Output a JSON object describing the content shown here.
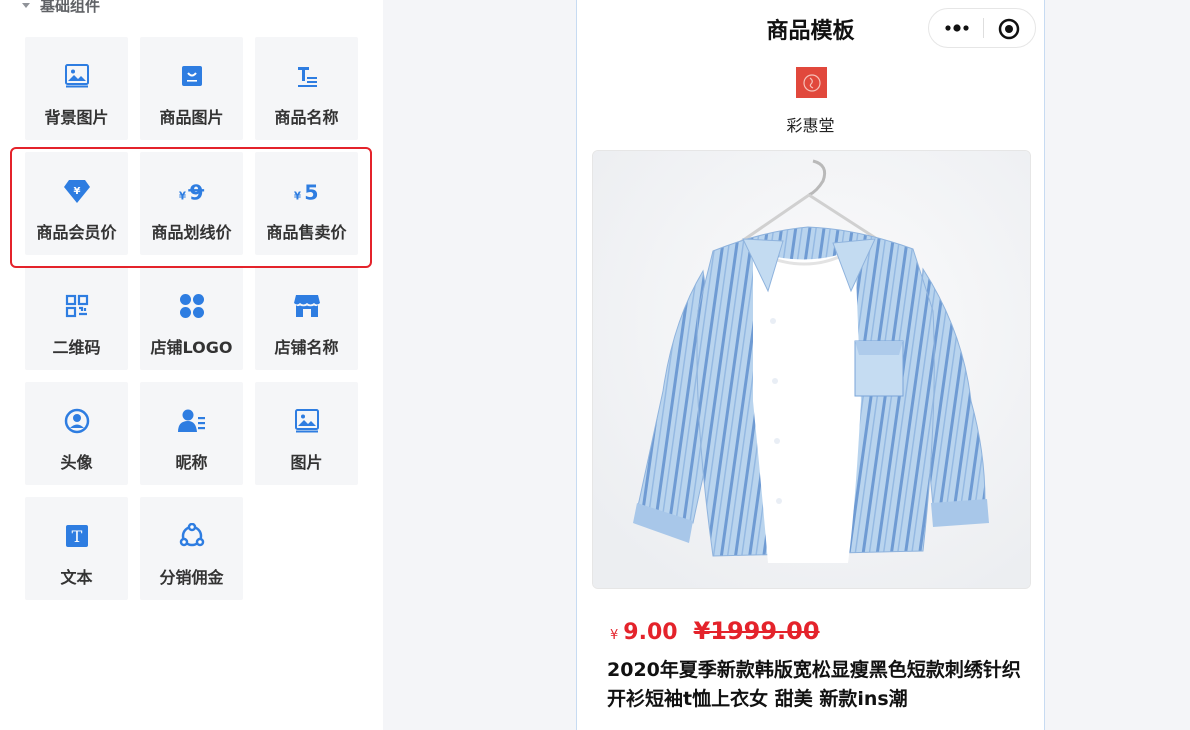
{
  "panel": {
    "section_title": "基础组件",
    "components": [
      {
        "label": "背景图片",
        "icon": "background-image-icon"
      },
      {
        "label": "商品图片",
        "icon": "product-image-icon"
      },
      {
        "label": "商品名称",
        "icon": "product-name-icon"
      },
      {
        "label": "商品会员价",
        "icon": "member-price-icon",
        "icon_text": "¥"
      },
      {
        "label": "商品划线价",
        "icon": "strikethrough-price-icon",
        "icon_small": "¥",
        "icon_big": "9"
      },
      {
        "label": "商品售卖价",
        "icon": "sale-price-icon",
        "icon_small": "¥",
        "icon_big": "5"
      },
      {
        "label": "二维码",
        "icon": "qrcode-icon"
      },
      {
        "label": "店铺LOGO",
        "icon": "shop-logo-icon"
      },
      {
        "label": "店铺名称",
        "icon": "shop-name-icon"
      },
      {
        "label": "头像",
        "icon": "avatar-icon"
      },
      {
        "label": "昵称",
        "icon": "nickname-icon"
      },
      {
        "label": "图片",
        "icon": "image-icon"
      },
      {
        "label": "文本",
        "icon": "text-icon",
        "icon_text": "T"
      },
      {
        "label": "分销佣金",
        "icon": "commission-icon"
      }
    ],
    "highlight_color": "#e4232b",
    "icon_color": "#2e7de1"
  },
  "preview": {
    "page_title": "商品模板",
    "shop_name": "彩惠堂",
    "currency_symbol": "¥",
    "sale_price": "9.00",
    "original_price_text": "¥1999.00",
    "product_title": "2020年夏季新款韩版宽松显瘦黑色短款刺绣针织开衫短袖t恤上衣女 甜美 新款ins潮",
    "price_color": "#e4232b"
  }
}
